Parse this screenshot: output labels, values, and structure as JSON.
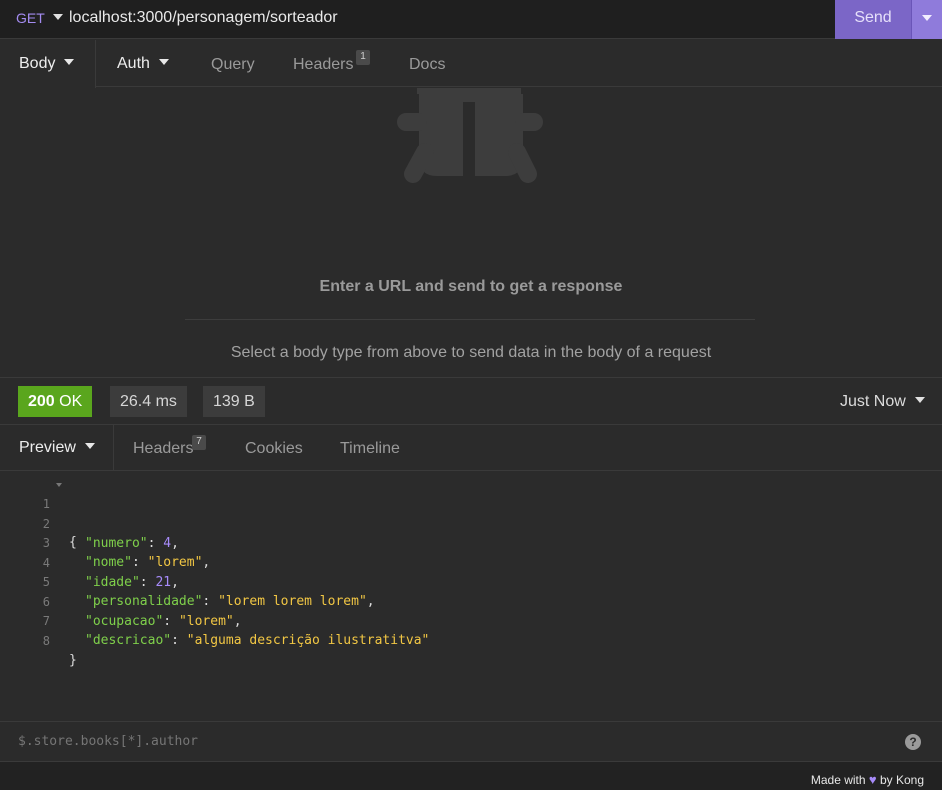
{
  "request": {
    "method": "GET",
    "url": "localhost:3000/personagem/sorteador",
    "send_label": "Send"
  },
  "request_tabs": [
    {
      "label": "Body"
    },
    {
      "label": "Auth"
    },
    {
      "label": "Query"
    },
    {
      "label": "Headers",
      "badge": "1"
    },
    {
      "label": "Docs"
    }
  ],
  "empty_state": {
    "icon": "bug-icon",
    "title": "Enter a URL and send to get a response",
    "subtitle": "Select a body type from above to send data in the body of a request"
  },
  "status": {
    "code": "200",
    "text": "OK",
    "time": "26.4 ms",
    "size": "139 B",
    "history": "Just Now"
  },
  "response_tabs": [
    {
      "label": "Preview"
    },
    {
      "label": "Headers",
      "badge": "7"
    },
    {
      "label": "Cookies"
    },
    {
      "label": "Timeline"
    }
  ],
  "response_body": {
    "line_numbers": [
      "1",
      "2",
      "3",
      "4",
      "5",
      "6",
      "7",
      "8"
    ],
    "open_brace": "{",
    "close_brace": "}",
    "fields": [
      {
        "key": "\"numero\"",
        "value": "4",
        "type": "number",
        "comma": ","
      },
      {
        "key": "\"nome\"",
        "value": "\"lorem\"",
        "type": "string",
        "comma": ","
      },
      {
        "key": "\"idade\"",
        "value": "21",
        "type": "number",
        "comma": ","
      },
      {
        "key": "\"personalidade\"",
        "value": "\"lorem lorem lorem\"",
        "type": "string",
        "comma": ","
      },
      {
        "key": "\"ocupacao\"",
        "value": "\"lorem\"",
        "type": "string",
        "comma": ","
      },
      {
        "key": "\"descricao\"",
        "value": "\"alguma descrição ilustratitva\"",
        "type": "string",
        "comma": ""
      }
    ]
  },
  "filter": {
    "placeholder": "$.store.books[*].author",
    "help_icon": "question-icon",
    "help_glyph": "?"
  },
  "footer": {
    "made_with": "Made with",
    "heart": "♥",
    "by": "by Kong"
  },
  "colors": {
    "accent": "#7b66c7",
    "ok": "#5aa61d",
    "json_key": "#7fd04b",
    "json_string": "#f2c744",
    "json_number": "#a78bfa"
  }
}
